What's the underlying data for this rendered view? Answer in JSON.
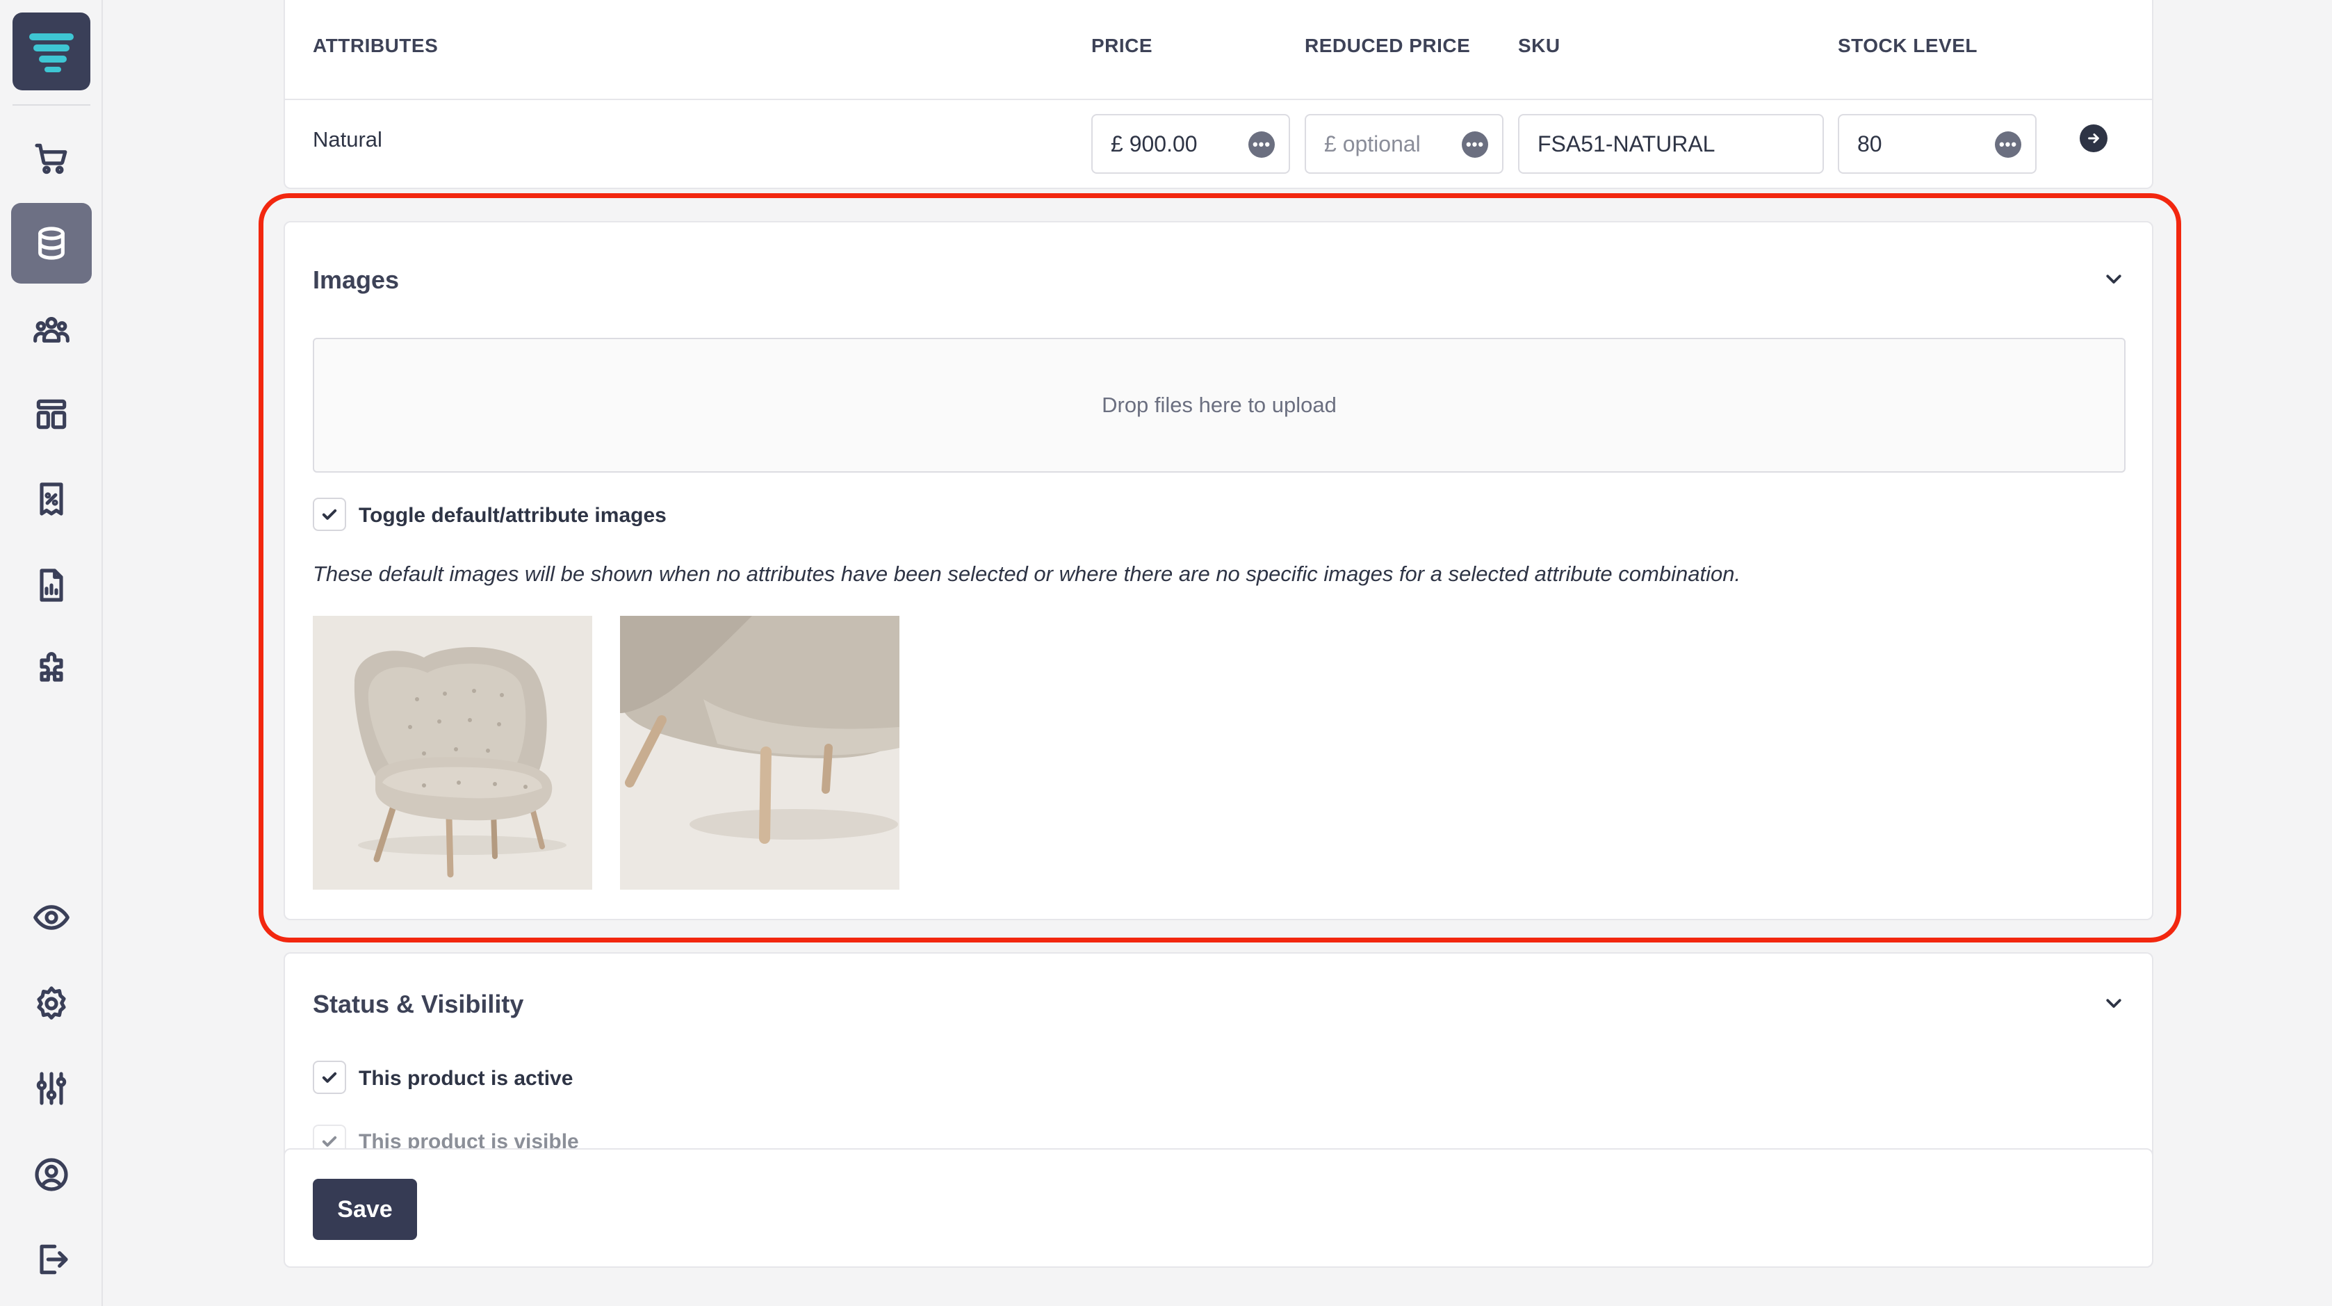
{
  "variants": {
    "headers": {
      "attributes": "ATTRIBUTES",
      "price": "PRICE",
      "reduced_price": "REDUCED PRICE",
      "sku": "SKU",
      "stock_level": "STOCK LEVEL"
    },
    "row": {
      "attribute": "Natural",
      "currency": "£",
      "price": "900.00",
      "reduced_price_placeholder": "optional",
      "sku": "FSA51-NATURAL",
      "stock_level": "80",
      "more_glyph": "•••"
    }
  },
  "images": {
    "title": "Images",
    "dropzone_text": "Drop files here to upload",
    "toggle_label": "Toggle default/attribute images",
    "toggle_checked": true,
    "note": "These default images will be shown when no attributes have been selected or where there are no specific images for a selected attribute combination."
  },
  "status": {
    "title": "Status & Visibility",
    "active_label": "This product is active",
    "visible_label": "This product is visible"
  },
  "actions": {
    "save_label": "Save"
  },
  "colors": {
    "highlight": "#f2270f",
    "primary": "#363b54",
    "logo_accent": "#3ec6d3"
  },
  "sidebar": {
    "items": [
      "cart-icon",
      "database-icon",
      "users-icon",
      "layout-icon",
      "receipt-percent-icon",
      "report-icon",
      "puzzle-icon",
      "eye-icon",
      "gear-icon",
      "sliders-icon",
      "user-circle-icon",
      "logout-icon"
    ],
    "active": "database-icon"
  }
}
